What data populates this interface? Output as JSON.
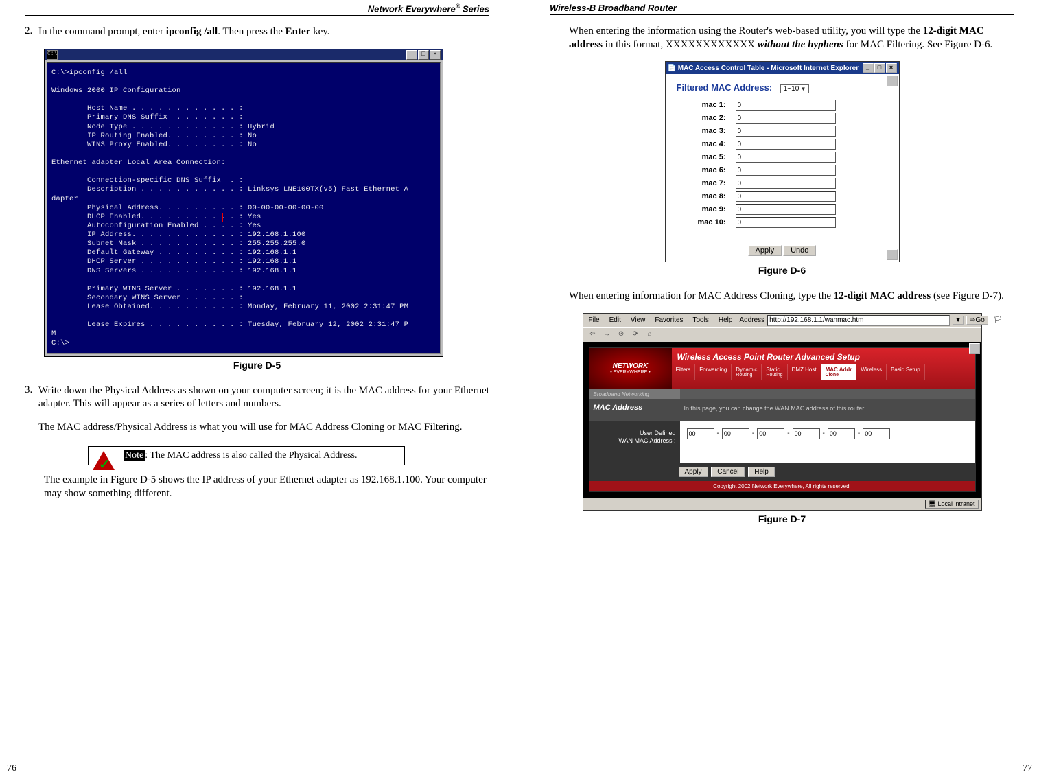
{
  "left": {
    "header_pre": "Network Everywhere",
    "header_sup": "®",
    "header_post": " Series",
    "step2_num": "2.",
    "step2_a": "In the command prompt, enter ",
    "step2_b": "ipconfig /all",
    "step2_c": ". Then press the ",
    "step2_d": "Enter",
    "step2_e": " key.",
    "fig5_caption": "Figure D-5",
    "term_title_icon": "C:\\",
    "term_lines": "C:\\>ipconfig /all\n\nWindows 2000 IP Configuration\n\n        Host Name . . . . . . . . . . . . :\n        Primary DNS Suffix  . . . . . . . :\n        Node Type . . . . . . . . . . . . : Hybrid\n        IP Routing Enabled. . . . . . . . : No\n        WINS Proxy Enabled. . . . . . . . : No\n\nEthernet adapter Local Area Connection:\n\n        Connection-specific DNS Suffix  . :\n        Description . . . . . . . . . . . : Linksys LNE100TX(v5) Fast Ethernet A\ndapter\n        Physical Address. . . . . . . . . : 00-00-00-00-00-00\n        DHCP Enabled. . . . . . . . . . . : Yes\n        Autoconfiguration Enabled . . . . : Yes\n        IP Address. . . . . . . . . . . . : 192.168.1.100\n        Subnet Mask . . . . . . . . . . . : 255.255.255.0\n        Default Gateway . . . . . . . . . : 192.168.1.1\n        DHCP Server . . . . . . . . . . . : 192.168.1.1\n        DNS Servers . . . . . . . . . . . : 192.168.1.1\n\n        Primary WINS Server . . . . . . . : 192.168.1.1\n        Secondary WINS Server . . . . . . :\n        Lease Obtained. . . . . . . . . . : Monday, February 11, 2002 2:31:47 PM\n\n        Lease Expires . . . . . . . . . . : Tuesday, February 12, 2002 2:31:47 P\nM\nC:\\>",
    "step3_num": "3.",
    "step3_p1": "Write down the Physical Address as shown on your computer screen; it is the MAC address for your Ethernet adapter.  This will appear as a series of letters and numbers.",
    "step3_p2": "The MAC address/Physical Address is what you will use for MAC Address Cloning or MAC Filtering.",
    "note_label": "Note",
    "note_text": ": The MAC address is also called the Physical Address.",
    "step3_p3": "The example in Figure D-5 shows the IP address of your Ethernet adapter as 192.168.1.100. Your computer may show something different.",
    "pagenum": "76"
  },
  "right": {
    "header": "Wireless-B Broadband Router",
    "p1_a": "When entering the information using the Router's web-based utility, you will type the ",
    "p1_b": "12-digit MAC address",
    "p1_c": " in this format, XXXXXXXXXXXX ",
    "p1_d": "without the hyphens",
    "p1_e": " for MAC Filtering. See Figure D-6.",
    "fig6": {
      "title": "MAC Access Control Table - Microsoft Internet Explorer",
      "heading": "Filtered MAC Address:",
      "range": "1~10",
      "rows": [
        {
          "label": "mac 1:",
          "val": "0"
        },
        {
          "label": "mac 2:",
          "val": "0"
        },
        {
          "label": "mac 3:",
          "val": "0"
        },
        {
          "label": "mac 4:",
          "val": "0"
        },
        {
          "label": "mac 5:",
          "val": "0"
        },
        {
          "label": "mac 6:",
          "val": "0"
        },
        {
          "label": "mac 7:",
          "val": "0"
        },
        {
          "label": "mac 8:",
          "val": "0"
        },
        {
          "label": "mac 9:",
          "val": "0"
        },
        {
          "label": "mac 10:",
          "val": "0"
        }
      ],
      "apply": "Apply",
      "undo": "Undo"
    },
    "fig6_caption": "Figure D-6",
    "p2_a": "When entering information for MAC Address Cloning, type the ",
    "p2_b": "12-digit MAC address",
    "p2_c": " (see Figure D-7).",
    "fig7": {
      "menu": {
        "file": "File",
        "edit": "Edit",
        "view": "View",
        "fav": "Favorites",
        "tools": "Tools",
        "help": "Help",
        "addr_label": "Address",
        "url": "http://192.168.1.1/wanmac.htm",
        "go": "Go"
      },
      "logo_top": "NETWORK",
      "logo_bot": "EVERYWHERE",
      "redtitle": "Wireless Access Point Router Advanced Setup",
      "tabs": [
        {
          "t": "Filters"
        },
        {
          "t": "Forwarding"
        },
        {
          "t": "Dynamic",
          "s": "Routing"
        },
        {
          "t": "Static",
          "s": "Routing"
        },
        {
          "t": "DMZ Host"
        },
        {
          "t": "MAC Addr",
          "s": "Clone",
          "active": true
        },
        {
          "t": "Wireless"
        },
        {
          "t": "Basic Setup"
        }
      ],
      "subleft": "Broadband Networking",
      "mainleft": "MAC Address",
      "maindesc": "In this page, you can change the WAN MAC address of this router.",
      "formleft1": "User Defined",
      "formleft2": "WAN MAC Address :",
      "mac": [
        "00",
        "00",
        "00",
        "00",
        "00",
        "00"
      ],
      "apply": "Apply",
      "cancel": "Cancel",
      "help": "Help",
      "footer": "Copyright 2002 Network Everywhere, All rights reserved.",
      "status": "Local intranet"
    },
    "fig7_caption": "Figure D-7",
    "pagenum": "77"
  }
}
